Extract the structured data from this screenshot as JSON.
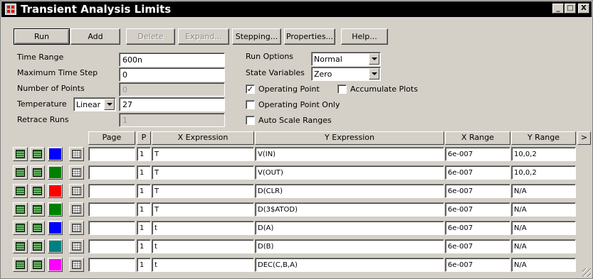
{
  "window": {
    "title": "Transient Analysis Limits",
    "minimize": "_",
    "maximize": "□",
    "close": "X"
  },
  "toolbar": {
    "run": "Run",
    "add": "Add",
    "delete": "Delete",
    "expand": "Expand...",
    "stepping": "Stepping...",
    "properties": "Properties...",
    "help": "Help..."
  },
  "settings": {
    "time_range_label": "Time Range",
    "time_range": "600n",
    "max_step_label": "Maximum Time Step",
    "max_step": "0",
    "num_points_label": "Number of Points",
    "num_points": "0",
    "temperature_label": "Temperature",
    "temperature_mode": "Linear",
    "temperature": "27",
    "retrace_label": "Retrace Runs",
    "retrace": "1",
    "run_options_label": "Run Options",
    "run_options": "Normal",
    "state_vars_label": "State Variables",
    "state_vars": "Zero",
    "operating_point_label": "Operating Point",
    "operating_point_checked": true,
    "accumulate_label": "Accumulate Plots",
    "accumulate_checked": false,
    "op_only_label": "Operating Point Only",
    "op_only_checked": false,
    "auto_scale_label": "Auto Scale Ranges",
    "auto_scale_checked": false
  },
  "table": {
    "headers": {
      "page": "Page",
      "p": "P",
      "x_expr": "X Expression",
      "y_expr": "Y Expression",
      "x_range": "X Range",
      "y_range": "Y Range",
      "more": ">"
    },
    "rows": [
      {
        "color": "#0000ff",
        "page": "",
        "p": "1",
        "x": "T",
        "y": "V(IN)",
        "xr": "6e-007",
        "yr": "10,0,2"
      },
      {
        "color": "#008000",
        "page": "",
        "p": "1",
        "x": "T",
        "y": "V(OUT)",
        "xr": "6e-007",
        "yr": "10,0,2"
      },
      {
        "color": "#ff0000",
        "page": "",
        "p": "1",
        "x": "T",
        "y": "D(CLR)",
        "xr": "6e-007",
        "yr": "N/A"
      },
      {
        "color": "#008000",
        "page": "",
        "p": "1",
        "x": "T",
        "y": "D(3$ATOD)",
        "xr": "6e-007",
        "yr": "N/A"
      },
      {
        "color": "#0000ff",
        "page": "",
        "p": "1",
        "x": "t",
        "y": "D(A)",
        "xr": "6e-007",
        "yr": "N/A"
      },
      {
        "color": "#008080",
        "page": "",
        "p": "1",
        "x": "t",
        "y": "D(B)",
        "xr": "6e-007",
        "yr": "N/A"
      },
      {
        "color": "#ff00ff",
        "page": "",
        "p": "1",
        "x": "t",
        "y": "DEC(C,B,A)",
        "xr": "6e-007",
        "yr": "N/A"
      }
    ]
  }
}
